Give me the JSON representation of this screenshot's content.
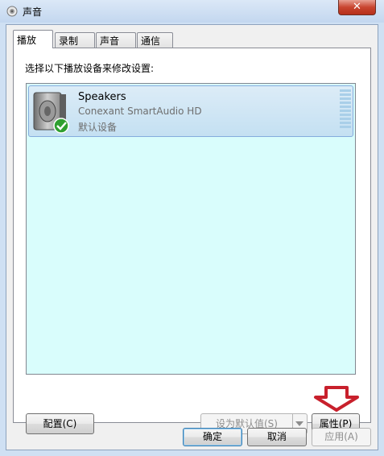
{
  "window": {
    "title": "声音",
    "close_symbol": "✕"
  },
  "tabs": [
    {
      "label": "播放",
      "active": true
    },
    {
      "label": "录制",
      "active": false
    },
    {
      "label": "声音",
      "active": false
    },
    {
      "label": "通信",
      "active": false
    }
  ],
  "panel": {
    "instruction": "选择以下播放设备来修改设置:",
    "devices": [
      {
        "name": "Speakers",
        "description": "Conexant SmartAudio HD",
        "status": "默认设备",
        "icon": "speaker-icon"
      }
    ]
  },
  "buttons": {
    "configure": "配置(C)",
    "set_default": "设为默认值(S)",
    "properties": "属性(P)",
    "ok": "确定",
    "cancel": "取消",
    "apply": "应用(A)"
  },
  "colors": {
    "list_bg": "#d9fdfc",
    "arrow": "#c8202c",
    "selected_item": "#c4e0f2"
  }
}
